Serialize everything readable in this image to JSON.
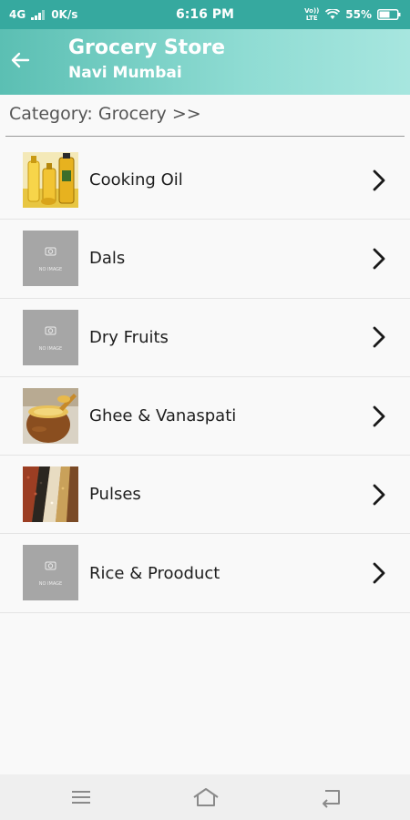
{
  "status_bar": {
    "network": "4G",
    "speed": "0K/s",
    "time": "6:16 PM",
    "volte": "Vo)) LTE",
    "battery": "55%"
  },
  "header": {
    "title": "Grocery Store",
    "subtitle": "Navi Mumbai",
    "back_icon": "arrow-left-icon"
  },
  "breadcrumb": "Category: Grocery >>",
  "placeholder_text": "NO IMAGE",
  "items": [
    {
      "label": "Cooking Oil",
      "image": "oil-bottles-photo"
    },
    {
      "label": "Dals",
      "image": "no-image-placeholder"
    },
    {
      "label": "Dry Fruits",
      "image": "no-image-placeholder"
    },
    {
      "label": "Ghee & Vanaspati",
      "image": "ghee-pot-photo"
    },
    {
      "label": "Pulses",
      "image": "pulses-photo"
    },
    {
      "label": "Rice & Prooduct",
      "image": "no-image-placeholder"
    }
  ],
  "nav": {
    "menu_icon": "menu-icon",
    "home_icon": "home-icon",
    "back_icon": "back-icon"
  },
  "colors": {
    "status_bar": "#36a99f",
    "header_start": "#5bbfb3",
    "header_end": "#a7e6df",
    "placeholder": "#a6a6a6"
  }
}
